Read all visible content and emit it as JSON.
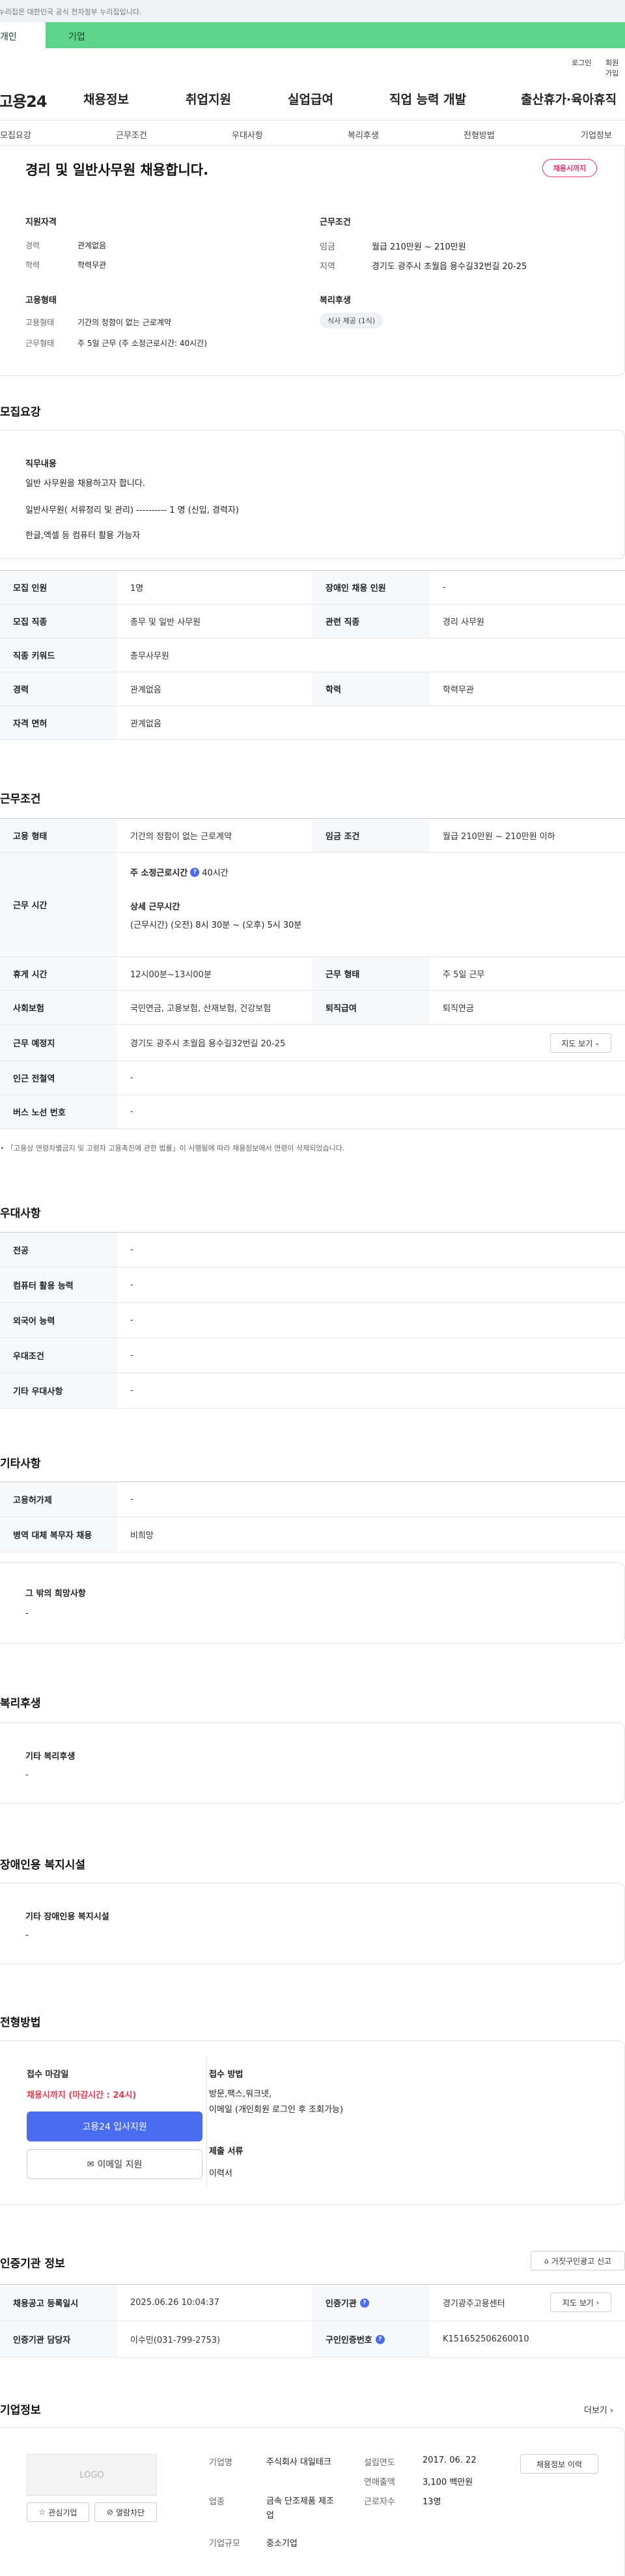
{
  "gov_notice": "이 누리집은 대한민국 공식 전자정부 누리집입니다.",
  "green_tabs": [
    "개인",
    "기업"
  ],
  "util": {
    "login": "로그인",
    "join": "회원가입"
  },
  "gnb": {
    "logo": "고용24",
    "menu": [
      "채용정보",
      "취업지원",
      "실업급여",
      "직업 능력 개발",
      "출산휴가·육아휴직"
    ]
  },
  "anchor_tabs": [
    "모집요강",
    "근무조건",
    "우대사항",
    "복리후생",
    "전형방법",
    "기업정보"
  ],
  "job": {
    "title": "경리 및 일반사무원 채용합니다.",
    "status_badge": "채용시까지",
    "qualification": {
      "heading": "지원자격",
      "career_label": "경력",
      "career_value": "관계없음",
      "edu_label": "학력",
      "edu_value": "학력무관"
    },
    "conditions": {
      "heading": "근무조건",
      "wage_label": "임금",
      "wage_value": "월급 210만원 ~ 210만원",
      "region_label": "지역",
      "region_value": "경기도 광주시 초월읍 용수길32번길 20-25"
    },
    "employment": {
      "heading": "고용형태",
      "type_label": "고용형태",
      "type_value": "기간의 정함이 없는 근로계약",
      "form_label": "근무형태",
      "form_value": "주 5일 근무 (주 소정근로시간: 40시간)"
    },
    "welfare": {
      "heading": "복리후생",
      "tag": "식사 제공 (1식)"
    }
  },
  "recruit": {
    "section_title": "모집요강",
    "duty_heading": "직무내용",
    "duty_lines": [
      "일반 사무원을 채용하고자 합니다.",
      "일반사무원( 서류정리 및 관리) ---------- 1 명 (신입, 경력자)",
      "한글,엑셀 등 컴퓨터 활용 가능자"
    ],
    "rows": [
      {
        "l1": "모집 인원",
        "v1": "1명",
        "l2": "장애인 채용 인원",
        "v2": "-"
      },
      {
        "l1": "모집 직종",
        "v1": "총무 및 일반 사무원",
        "l2": "관련 직종",
        "v2": "경리 사무원"
      },
      {
        "l1": "직종 키워드",
        "v1": "총무사무원",
        "l2": "",
        "v2": ""
      },
      {
        "l1": "경력",
        "v1": "관계없음",
        "l2": "학력",
        "v2": "학력무관"
      },
      {
        "l1": "자격 면허",
        "v1": "관계없음",
        "l2": "",
        "v2": ""
      }
    ]
  },
  "work": {
    "section_title": "근무조건",
    "r1": {
      "l1": "고용 형태",
      "v1": "기간의 정함이 없는 근로계약",
      "l2": "임금 조건",
      "v2": "월급 210만원 ~ 210만원 이하"
    },
    "hours": {
      "label": "근무 시간",
      "weekly_label": "주 소정근로시간",
      "weekly_value": "40시간",
      "detail_heading": "상세 근무시간",
      "detail_value": "(근무시간) (오전) 8시 30분 ~ (오후) 5시 30분"
    },
    "r3": {
      "l1": "휴게 시간",
      "v1": "12시00분~13시00분",
      "l2": "근무 형태",
      "v2": "주 5일 근무"
    },
    "r4": {
      "l1": "사회보험",
      "v1": "국민연금, 고용보험, 산재보험, 건강보험",
      "l2": "퇴직급여",
      "v2": "퇴직연금"
    },
    "r5": {
      "l1": "근무 예정지",
      "v1": "경기도 광주시 초월읍 용수길32번길 20-25",
      "map_button": "지도 보기"
    },
    "r6": {
      "l1": "인근 전철역",
      "v1": "-"
    },
    "r7": {
      "l1": "버스 노선 번호",
      "v1": "-"
    },
    "note": "「고용상 연령차별금지 및 고령자 고용촉진에 관한 법률」이 시행됨에 따라 채용정보에서 연령이 삭제되었습니다."
  },
  "pref": {
    "section_title": "우대사항",
    "rows": [
      {
        "label": "전공",
        "value": "-"
      },
      {
        "label": "컴퓨터 활용 능력",
        "value": "-"
      },
      {
        "label": "외국어 능력",
        "value": "-"
      },
      {
        "label": "우대조건",
        "value": "-"
      },
      {
        "label": "기타 우대사항",
        "value": "-"
      }
    ]
  },
  "etc": {
    "section_title": "기타사항",
    "rows": [
      {
        "label": "고용허가제",
        "value": "-"
      },
      {
        "label": "병역 대체 복무자 채용",
        "value": "비희망"
      }
    ],
    "box_heading": "그 밖의 희망사항",
    "box_value": "-"
  },
  "benefits": {
    "section_title": "복리후생",
    "box_heading": "기타 복리후생",
    "box_value": "-"
  },
  "disability": {
    "section_title": "장애인용 복지시설",
    "box_heading": "기타 장애인용 복지시설",
    "box_value": "-"
  },
  "process": {
    "section_title": "전형방법",
    "deadline_label": "접수 마감일",
    "deadline_value": "채용시까지 (마감시간 : 24시)",
    "apply_button": "고용24 입사지원",
    "email_button": "이메일 지원",
    "method_label": "접수 방법",
    "method_value": "방문,팩스,워크넷,\n이메일 (개인회원 로그인 후 조회가능)",
    "docs_label": "제출 서류",
    "docs_value": "이력서"
  },
  "cert": {
    "section_title": "인증기관 정보",
    "report_button": "거짓구인광고 신고",
    "r1": {
      "l1": "채용공고 등록일시",
      "v1": "2025.06.26 10:04:37",
      "l2": "인증기관",
      "v2": "경기광주고용센터",
      "map_button": "지도 보기"
    },
    "r2": {
      "l1": "인증기관 담당자",
      "v1": "이수민(031-799-2753)",
      "l2": "구인인증번호",
      "v2": "K151652506260010"
    }
  },
  "company": {
    "section_title": "기업정보",
    "more": "더보기",
    "logo_text": "LOGO",
    "interest_button": "관심기업",
    "block_button": "열람차단",
    "name_label": "기업명",
    "name_value": "주식회사 대일테크",
    "industry_label": "업종",
    "industry_value": "금속 단조제품 제조업",
    "scale_label": "기업규모",
    "scale_value": "중소기업",
    "founded_label": "설립연도",
    "founded_value": "2017. 06. 22",
    "sales_label": "연매출액",
    "sales_value": "3,100 백만원",
    "employees_label": "근로자수",
    "employees_value": "13명",
    "jobs_button": "채용정보 이력"
  },
  "colors": {
    "accent_green": "#5ed38a",
    "primary_blue": "#4a6cf0",
    "alert_red": "#e8394f",
    "badge_pink": "#e4336b"
  }
}
